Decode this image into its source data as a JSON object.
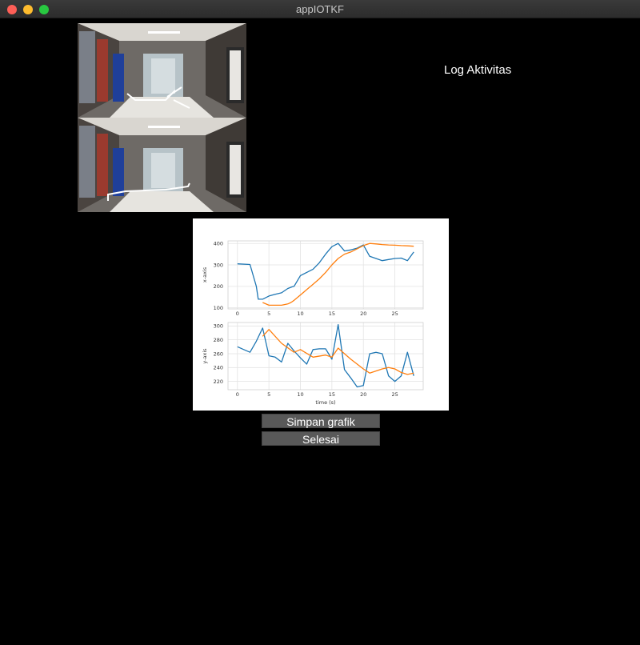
{
  "window": {
    "title": "appIOTKF"
  },
  "log": {
    "title": "Log Aktivitas"
  },
  "buttons": {
    "save": "Simpan grafik",
    "finish": "Selesai"
  },
  "colors": {
    "series1": "#1f77b4",
    "series2": "#ff7f0e",
    "background": "#000000",
    "button": "#595959"
  },
  "chart_data": [
    {
      "type": "line",
      "xlabel": "",
      "ylabel": "x-axis",
      "xlim": [
        -1.5,
        29.5
      ],
      "ylim": [
        95,
        412
      ],
      "xticks": [
        0,
        5,
        10,
        15,
        20,
        25
      ],
      "yticks": [
        100,
        200,
        300,
        400
      ],
      "grid": true,
      "series": [
        {
          "x": [
            0,
            2,
            3,
            3.3,
            4,
            5,
            6,
            7,
            8,
            8.7,
            9,
            10,
            11,
            12,
            13,
            14,
            15,
            16,
            17,
            18,
            19,
            20,
            21,
            22,
            23,
            24,
            25,
            26,
            27,
            28
          ],
          "values": [
            305,
            302,
            200,
            140,
            140,
            155,
            163,
            170,
            190,
            198,
            200,
            250,
            265,
            280,
            310,
            350,
            385,
            400,
            365,
            370,
            378,
            393,
            340,
            330,
            320,
            325,
            330,
            332,
            320,
            360
          ]
        },
        {
          "x": [
            4,
            5,
            6,
            7,
            8,
            8.5,
            9,
            10,
            11,
            12,
            13,
            14,
            15,
            16,
            17,
            18,
            19,
            20,
            21,
            22,
            23,
            24,
            25,
            26,
            27,
            28
          ],
          "values": [
            125,
            112,
            112,
            112,
            118,
            125,
            135,
            160,
            185,
            210,
            235,
            265,
            300,
            330,
            350,
            360,
            375,
            390,
            400,
            398,
            395,
            393,
            392,
            390,
            389,
            387
          ]
        }
      ]
    },
    {
      "type": "line",
      "xlabel": "time (s)",
      "ylabel": "y-axis",
      "xlim": [
        -1.5,
        29.5
      ],
      "ylim": [
        208,
        305
      ],
      "xticks": [
        0,
        5,
        10,
        15,
        20,
        25
      ],
      "yticks": [
        220,
        240,
        260,
        280,
        300
      ],
      "grid": true,
      "series": [
        {
          "x": [
            0,
            1,
            2,
            3,
            4,
            5,
            6,
            7,
            8,
            9,
            10,
            11,
            12,
            13,
            14,
            15,
            16,
            17,
            18,
            19,
            20,
            21,
            22,
            23,
            24,
            25,
            26,
            27,
            28
          ],
          "values": [
            270,
            266,
            262,
            278,
            297,
            257,
            255,
            248,
            275,
            264,
            254,
            245,
            266,
            267,
            267,
            252,
            302,
            237,
            225,
            212,
            214,
            260,
            262,
            260,
            228,
            220,
            228,
            262,
            228
          ]
        },
        {
          "x": [
            4,
            5,
            7,
            9,
            10,
            12,
            14,
            15,
            16,
            17,
            18,
            20,
            21,
            23,
            24,
            25,
            26,
            27,
            28
          ],
          "values": [
            285,
            295,
            275,
            262,
            266,
            255,
            258,
            255,
            268,
            260,
            252,
            238,
            232,
            238,
            240,
            238,
            233,
            230,
            232
          ]
        }
      ]
    }
  ]
}
